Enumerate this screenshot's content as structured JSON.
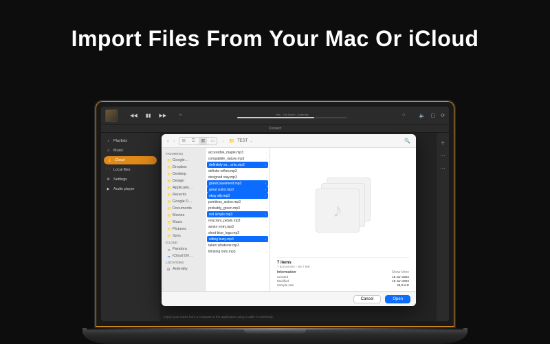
{
  "headline": "Import Files From Your Mac Or iCloud",
  "topbar": {
    "now_playing": "Hat - The Brush - Ardentity",
    "time_elapsed": "00",
    "time_total": "01",
    "connect_label": "Connect"
  },
  "sidebar": {
    "items": [
      {
        "icon": "♪",
        "label": "Playlists"
      },
      {
        "icon": "♫",
        "label": "Music"
      },
      {
        "icon": "⤓",
        "label": "Cloud"
      },
      {
        "icon": "🗀",
        "label": "Local files"
      },
      {
        "icon": "⚙",
        "label": "Settings"
      },
      {
        "icon": "▶",
        "label": "Audio player"
      }
    ],
    "active_index": 2
  },
  "dialog": {
    "location_label": "TEST",
    "sidebar_sections": [
      {
        "title": "Favorites",
        "items": [
          {
            "label": "Google…",
            "icon": "folder"
          },
          {
            "label": "Dropbox",
            "icon": "folder"
          },
          {
            "label": "Desktop",
            "icon": "folder"
          },
          {
            "label": "Design",
            "icon": "folder"
          },
          {
            "label": "Applicatio…",
            "icon": "folder"
          },
          {
            "label": "Recents",
            "icon": "folder"
          },
          {
            "label": "Google D…",
            "icon": "folder"
          },
          {
            "label": "Documents",
            "icon": "folder"
          },
          {
            "label": "Movies",
            "icon": "folder"
          },
          {
            "label": "Music",
            "icon": "folder"
          },
          {
            "label": "Pictures",
            "icon": "folder"
          },
          {
            "label": "Sync",
            "icon": "folder"
          }
        ]
      },
      {
        "title": "iCloud",
        "items": [
          {
            "label": "Pandora",
            "icon": "cloud"
          },
          {
            "label": "iCloud Dri…",
            "icon": "cloud"
          }
        ]
      },
      {
        "title": "Locations",
        "items": [
          {
            "label": "Ardentity",
            "icon": "drive"
          }
        ]
      }
    ],
    "files": [
      {
        "name": "accessible_maple.mp3",
        "selected": false
      },
      {
        "name": "compatible_nature.mp3",
        "selected": false
      },
      {
        "name": "definitely wr…onic.mp3",
        "selected": true
      },
      {
        "name": "definite reflow.mp3",
        "selected": false
      },
      {
        "name": "designed stay.mp3",
        "selected": false
      },
      {
        "name": "grand pavement.mp3",
        "selected": true
      },
      {
        "name": "great suitor.mp3",
        "selected": true
      },
      {
        "name": "okay ally.mp3",
        "selected": true
      },
      {
        "name": "pointless_action.mp3",
        "selected": false
      },
      {
        "name": "probably_green.mp3",
        "selected": false
      },
      {
        "name": "red simple.mp3",
        "selected": true
      },
      {
        "name": "reluctant_petals.mp3",
        "selected": false
      },
      {
        "name": "senior entry.mp3",
        "selected": false
      },
      {
        "name": "short blue_legs.mp3",
        "selected": false
      },
      {
        "name": "sitting busy.mp3",
        "selected": true
      },
      {
        "name": "taken whatever.mp3",
        "selected": false
      },
      {
        "name": "thinking onto.mp3",
        "selected": false
      }
    ],
    "info": {
      "count_label": "7 items",
      "subtitle": "7 documents – 65,7 MB",
      "section_label": "Information",
      "show_more": "Show More",
      "rows": [
        {
          "k": "Created",
          "v": "18 Jun 2022"
        },
        {
          "k": "Modified",
          "v": "18 Jun 2022"
        },
        {
          "k": "Sample rate",
          "v": "48,0 kHz"
        }
      ]
    },
    "cancel_label": "Cancel",
    "open_label": "Open"
  },
  "hint": "Import your music from a computer to the application using a cable or wirelessly"
}
